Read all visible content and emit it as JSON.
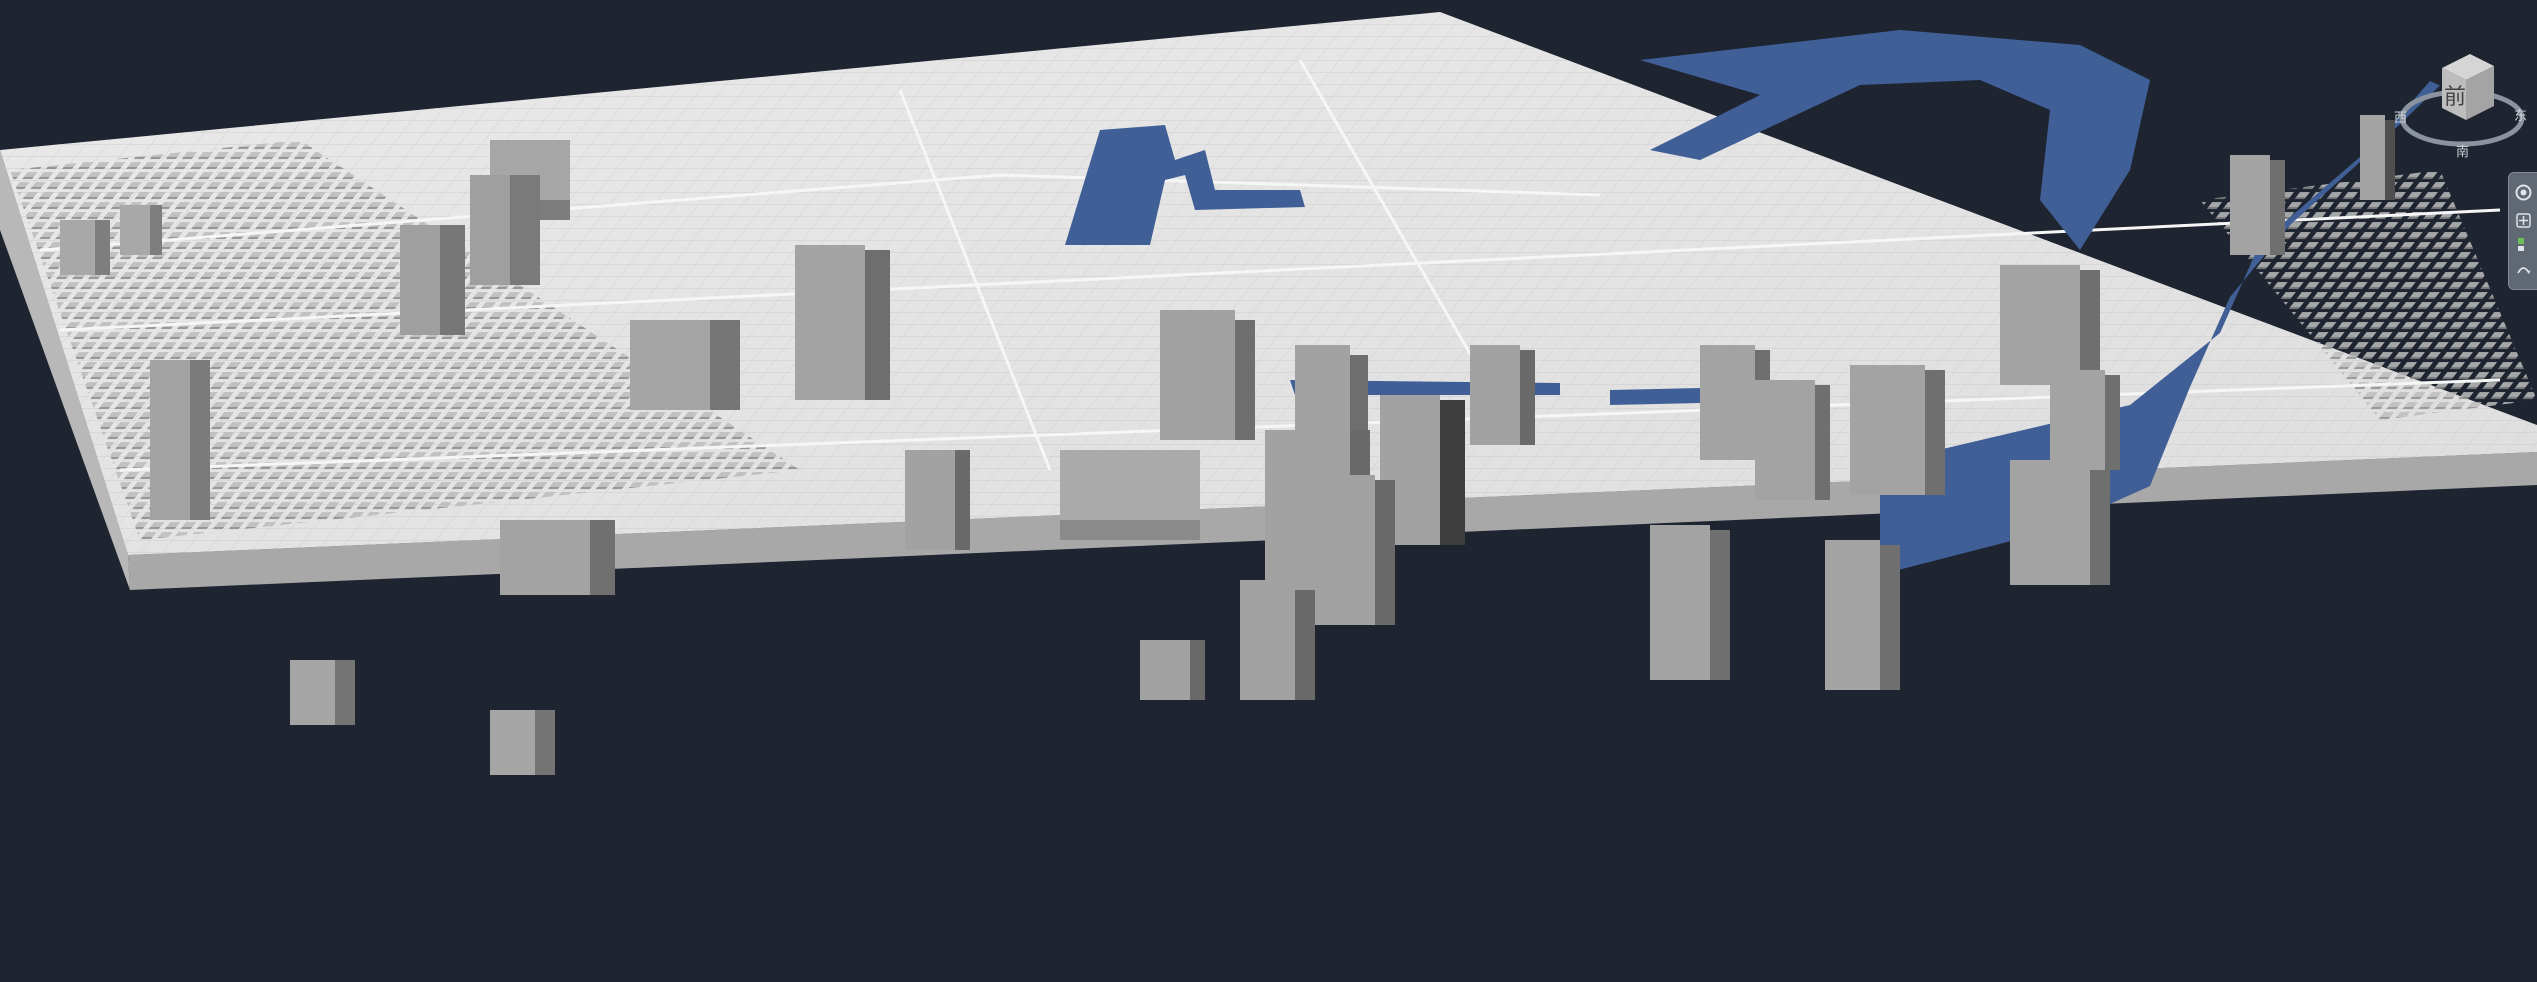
{
  "viewport": {
    "background": "#1e2430",
    "model": {
      "top_color": "#e6e6e6",
      "side_color": "#a9a9a9",
      "water_color": "#3f5f96",
      "building_color": "#9e9e9e"
    }
  },
  "viewcube": {
    "face_label": "前",
    "compass_left": "西",
    "compass_right": "东",
    "compass_bottom": "南"
  },
  "navigation_bar": {
    "items": [
      {
        "name": "steering-wheel"
      },
      {
        "name": "pan"
      },
      {
        "name": "zoom"
      },
      {
        "name": "orbit"
      }
    ]
  }
}
